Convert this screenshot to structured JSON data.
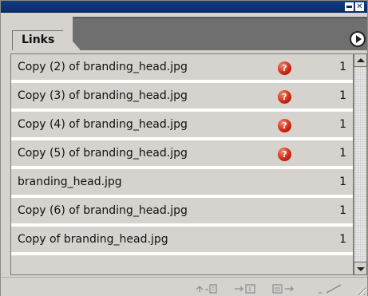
{
  "panel": {
    "tab_label": "Links"
  },
  "links": [
    {
      "name": "Copy (2) of branding_head.jpg",
      "count": "1",
      "missing": true,
      "warn_glyph": "?"
    },
    {
      "name": "Copy (3) of branding_head.jpg",
      "count": "1",
      "missing": true,
      "warn_glyph": "?"
    },
    {
      "name": "Copy (4) of branding_head.jpg",
      "count": "1",
      "missing": true,
      "warn_glyph": "?"
    },
    {
      "name": "Copy (5) of branding_head.jpg",
      "count": "1",
      "missing": true,
      "warn_glyph": "?"
    },
    {
      "name": "branding_head.jpg",
      "count": "1",
      "missing": false
    },
    {
      "name": "Copy (6) of branding_head.jpg",
      "count": "1",
      "missing": false
    },
    {
      "name": "Copy of branding_head.jpg",
      "count": "1",
      "missing": false
    }
  ],
  "toolbar": {
    "relink_icon": "relink-icon",
    "goto_link_icon": "go-to-link-icon",
    "update_link_icon": "update-link-icon",
    "edit_original_icon": "edit-original-icon"
  },
  "colors": {
    "titlebar": "#0b2a66",
    "panel_bg": "#d6d3ce",
    "warning": "#cc2410"
  }
}
